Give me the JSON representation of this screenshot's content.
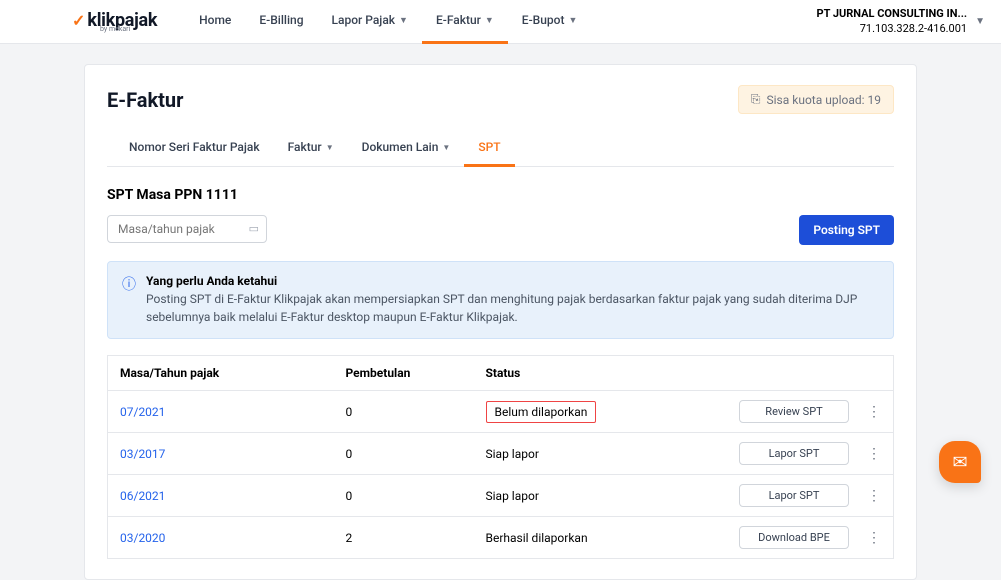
{
  "brand": {
    "check": "✓",
    "name": "klikpajak",
    "sub": "by mekari"
  },
  "nav": {
    "home": "Home",
    "ebilling": "E-Billing",
    "lapor": "Lapor Pajak",
    "efaktur": "E-Faktur",
    "ebupot": "E-Bupot"
  },
  "account": {
    "name": "PT JURNAL CONSULTING IN...",
    "id": "71.103.328.2-416.001"
  },
  "page": {
    "title": "E-Faktur"
  },
  "quota": {
    "label": "Sisa kuota upload: 19"
  },
  "subtabs": {
    "nsfp": "Nomor Seri Faktur Pajak",
    "faktur": "Faktur",
    "dokumen": "Dokumen Lain",
    "spt": "SPT"
  },
  "section": {
    "title": "SPT Masa PPN 1111"
  },
  "inputs": {
    "date_placeholder": "Masa/tahun pajak"
  },
  "buttons": {
    "posting": "Posting SPT"
  },
  "alert": {
    "title": "Yang perlu Anda ketahui",
    "text": "Posting SPT di E-Faktur Klikpajak akan mempersiapkan SPT dan menghitung pajak berdasarkan faktur pajak yang sudah diterima DJP sebelumnya baik melalui E-Faktur desktop maupun E-Faktur Klikpajak."
  },
  "table": {
    "headers": {
      "masa": "Masa/Tahun pajak",
      "pembetulan": "Pembetulan",
      "status": "Status"
    },
    "rows": [
      {
        "masa": "07/2021",
        "pembetulan": "0",
        "status": "Belum dilaporkan",
        "action": "Review SPT",
        "highlight": true
      },
      {
        "masa": "03/2017",
        "pembetulan": "0",
        "status": "Siap lapor",
        "action": "Lapor SPT",
        "highlight": false
      },
      {
        "masa": "06/2021",
        "pembetulan": "0",
        "status": "Siap lapor",
        "action": "Lapor SPT",
        "highlight": false
      },
      {
        "masa": "03/2020",
        "pembetulan": "2",
        "status": "Berhasil dilaporkan",
        "action": "Download BPE",
        "highlight": false
      }
    ]
  }
}
